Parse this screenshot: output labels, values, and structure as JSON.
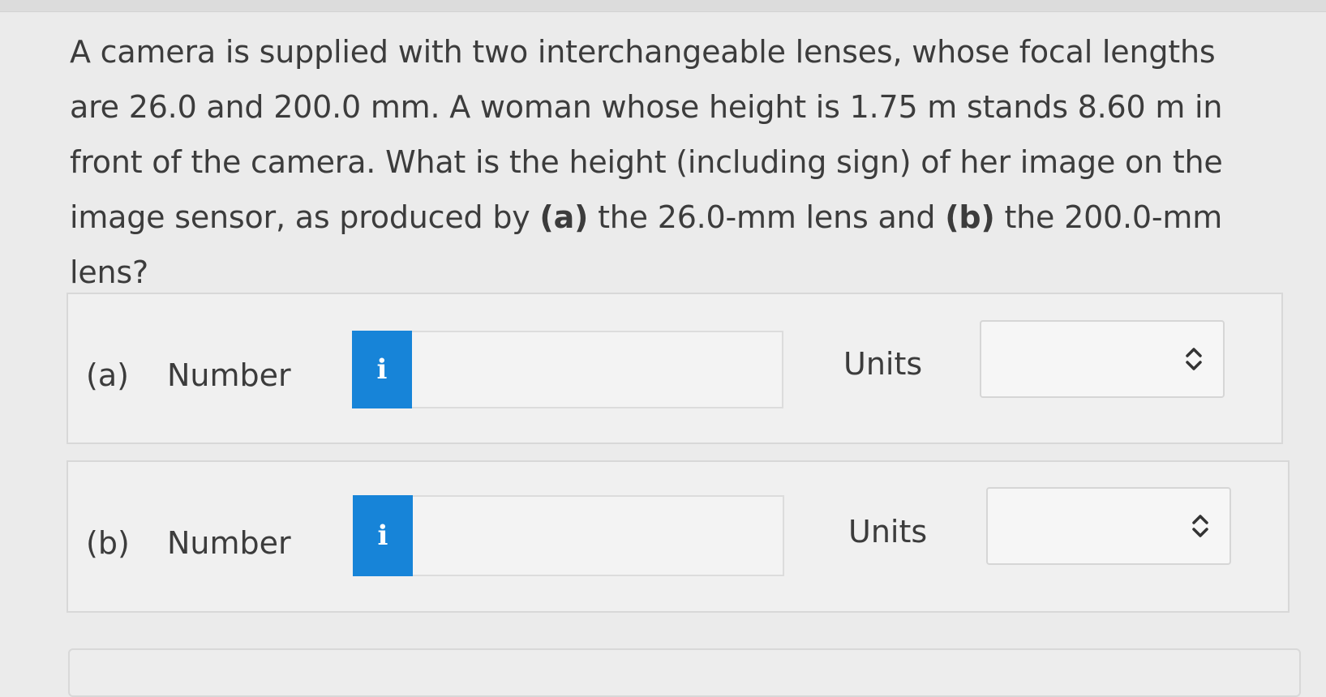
{
  "question": {
    "text_1": "A camera is supplied with two interchangeable lenses, whose focal lengths are 26.0 and 200.0 mm. A woman whose height is 1.75 m stands 8.60 m in front of the camera. What is the height (including sign) of her image on the image sensor, as produced by ",
    "part_a_marker": "(a)",
    "text_2": " the 26.0-mm lens and ",
    "part_b_marker": "(b)",
    "text_3": " the 200.0-mm lens?"
  },
  "parts": [
    {
      "letter": "(a)",
      "number_label": "Number",
      "info_glyph": "i",
      "number_value": "",
      "units_label": "Units",
      "units_selected": ""
    },
    {
      "letter": "(b)",
      "number_label": "Number",
      "info_glyph": "i",
      "number_value": "",
      "units_label": "Units",
      "units_selected": ""
    }
  ],
  "colors": {
    "info_blue": "#1784d8",
    "background": "#ebebeb"
  },
  "icons": {
    "info": "info-icon",
    "units_dropdown": "chevron-up-down-icon"
  }
}
